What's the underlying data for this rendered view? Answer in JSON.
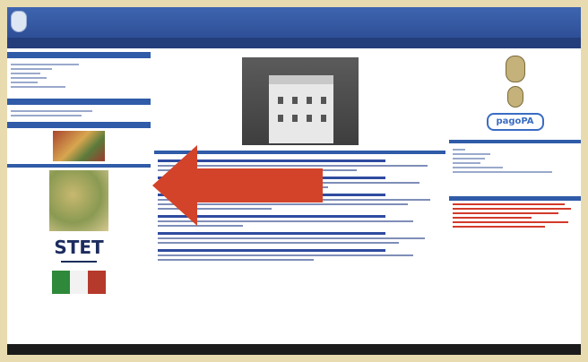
{
  "header": {
    "title": "",
    "subtitle": ""
  },
  "nav": {
    "items": [
      "",
      "",
      "",
      "",
      "",
      "",
      "",
      "",
      ""
    ]
  },
  "left": {
    "sections": [
      "",
      "",
      ""
    ],
    "sponsor_logo_text": "STET"
  },
  "right": {
    "logo_text": "pagoPA"
  },
  "colors": {
    "header": "#3f65b0",
    "nav": "#243e7c",
    "arrow": "#d2432a",
    "accent_red": "#d33a2a"
  },
  "icons": [
    "crest-icon",
    "arrow-left-icon"
  ]
}
